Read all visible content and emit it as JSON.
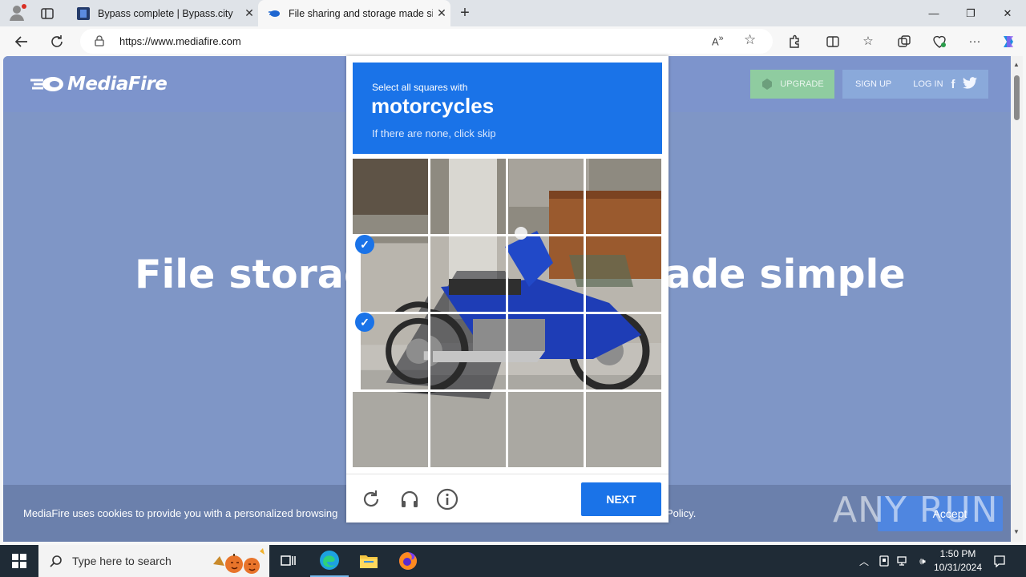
{
  "browser": {
    "tabs": [
      {
        "title": "Bypass complete | Bypass.city",
        "active": false
      },
      {
        "title": "File sharing and storage made simple",
        "active": true
      }
    ],
    "url": "https://www.mediafire.com"
  },
  "page": {
    "logo_text": "MediaFire",
    "upgrade_label": "UPGRADE",
    "signup_label": "SIGN UP",
    "login_label": "LOG IN",
    "hero_left": "File storag",
    "hero_right": "ade simple",
    "cookie_text": "MediaFire uses cookies to provide you with a personalized browsing",
    "cookie_policy": "Policy.",
    "accept_label": "Accept",
    "watermark": "ANY RUN"
  },
  "captcha": {
    "instruction": "Select all squares with",
    "target": "motorcycles",
    "hint": "If there are none, click skip",
    "selected_cells": [
      4,
      8
    ],
    "next_label": "NEXT",
    "accent": "#1a73e8"
  },
  "taskbar": {
    "search_placeholder": "Type here to search",
    "time": "1:50 PM",
    "date": "10/31/2024"
  }
}
